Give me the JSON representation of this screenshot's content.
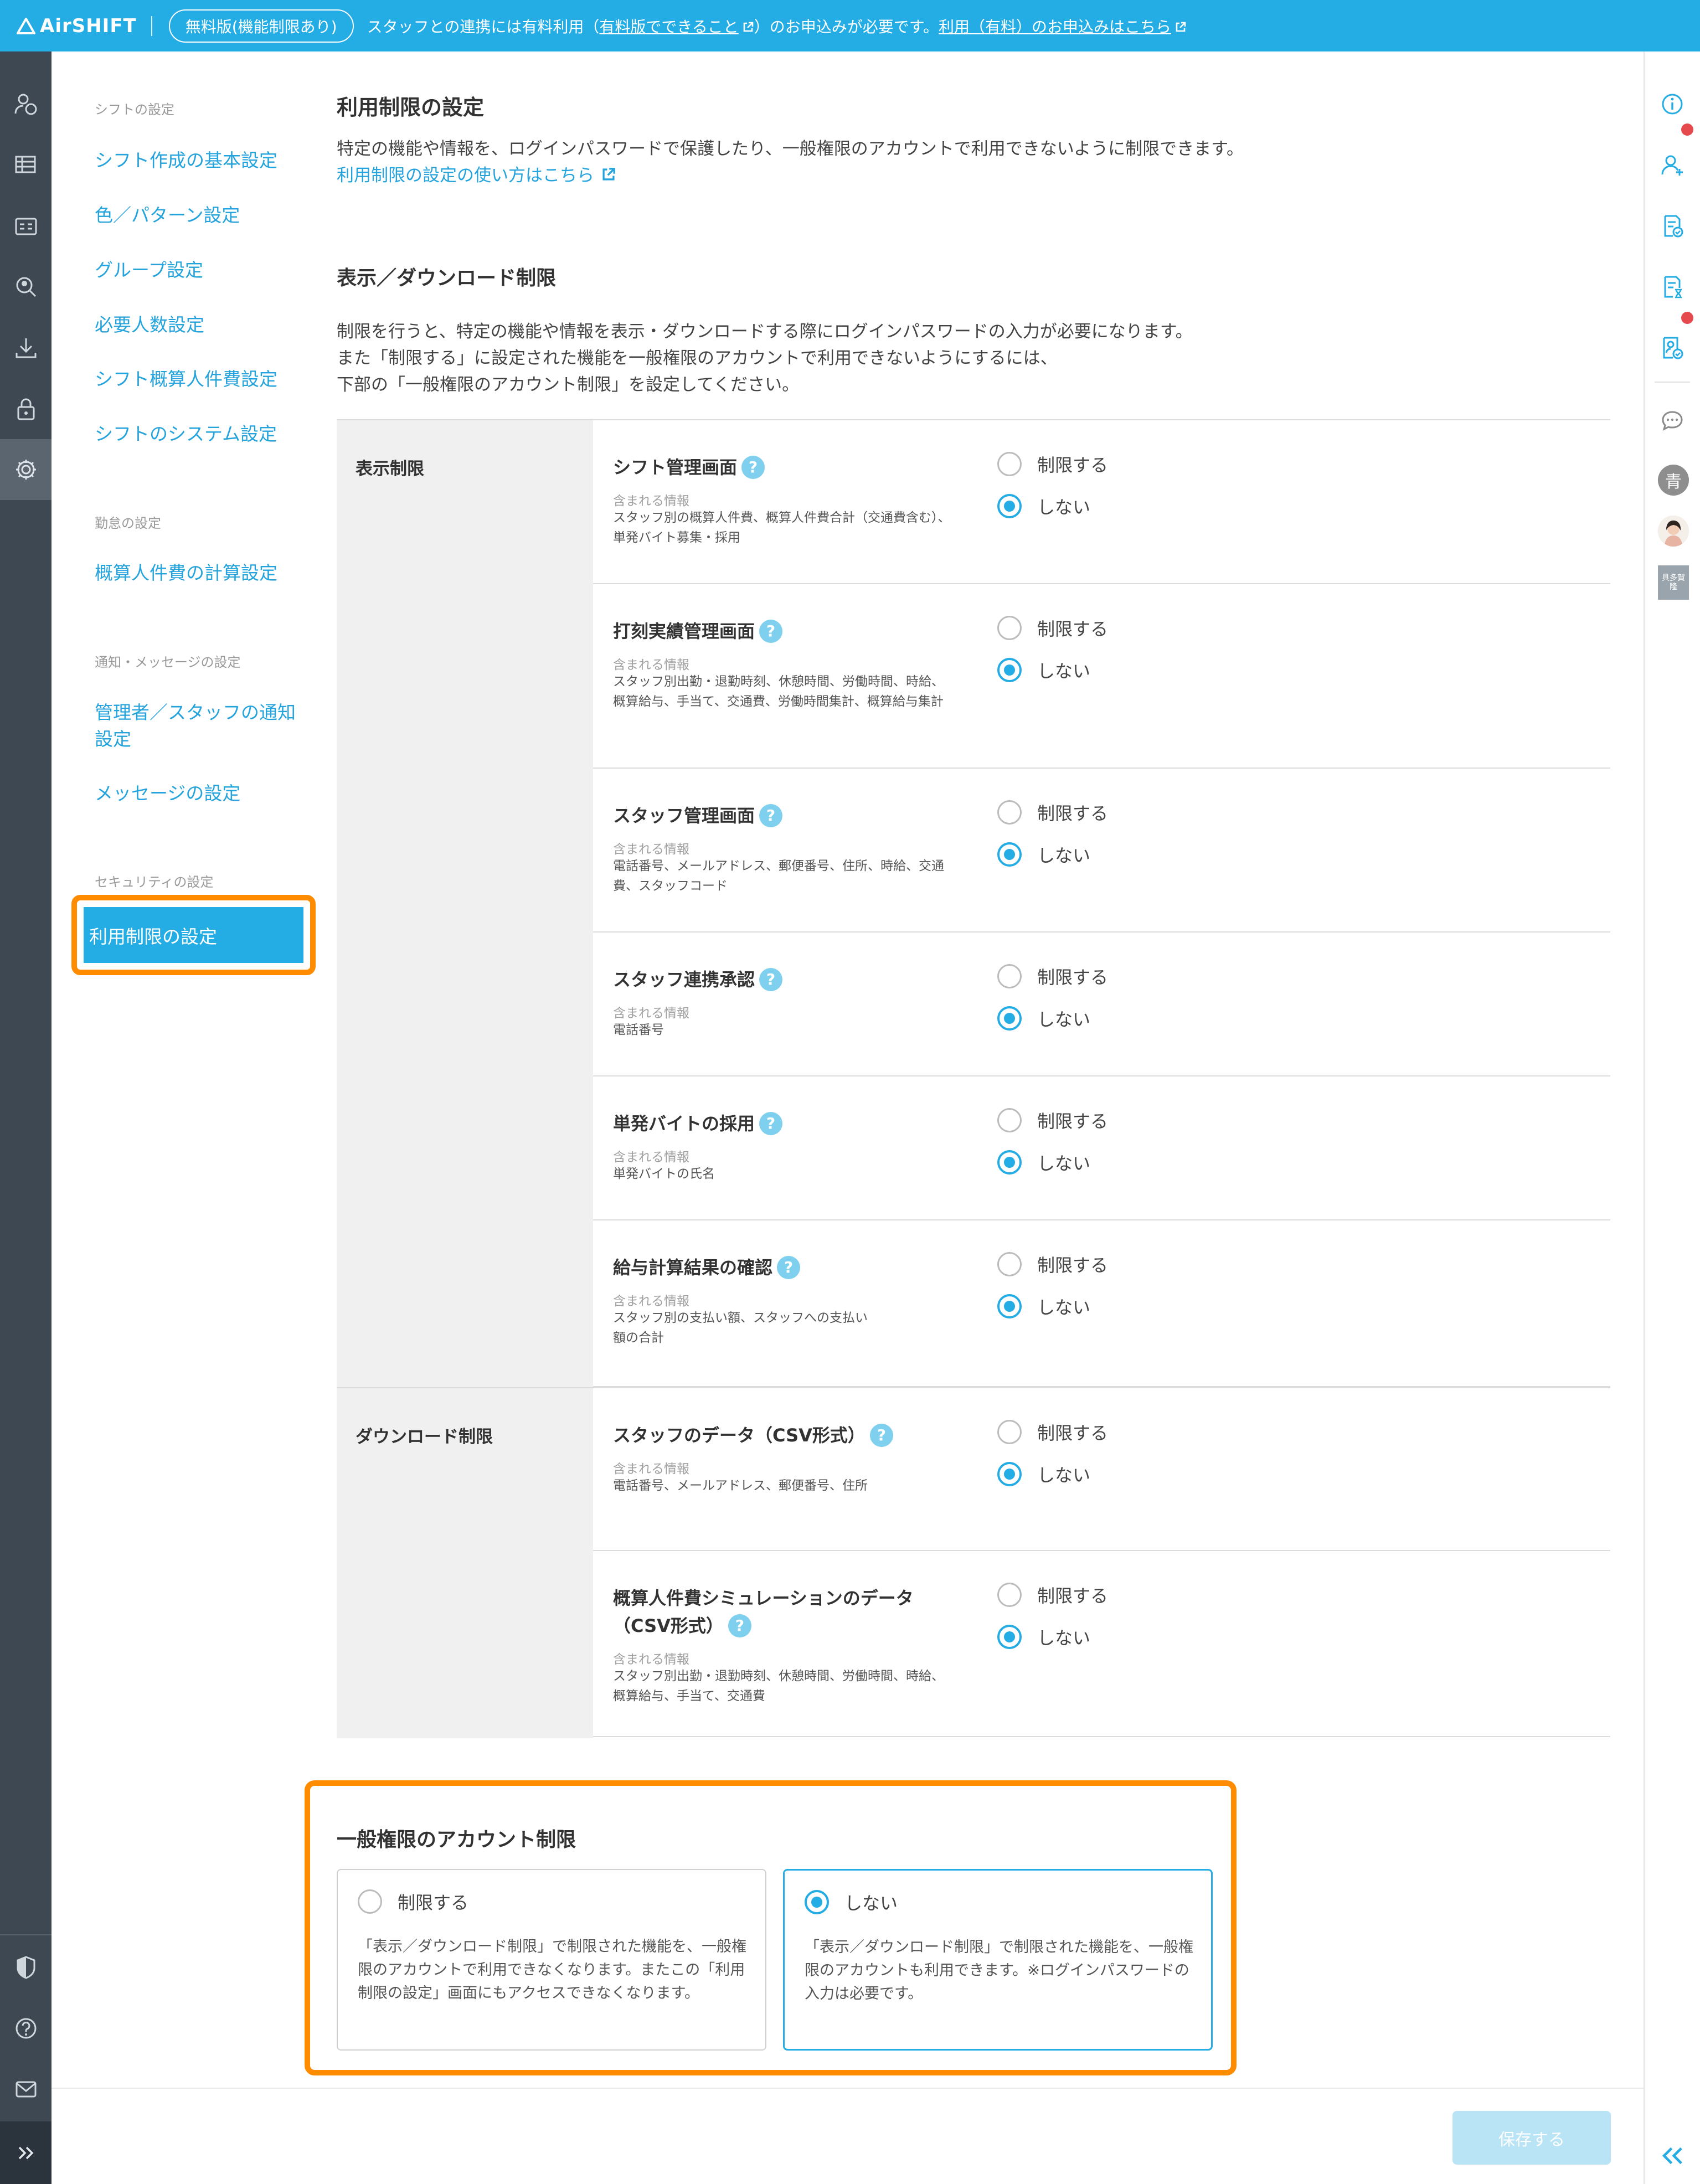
{
  "topbar": {
    "brand": "AirSHIFT",
    "plan_badge": "無料版(機能制限あり)",
    "msg_prefix": "スタッフとの連携には有料利用（",
    "msg_link1": "有料版でできること",
    "msg_middle": "）のお申込みが必要です。",
    "msg_link2": "利用（有料）のお申込みはこちら"
  },
  "nav": {
    "groups": [
      {
        "heading": "シフトの設定",
        "items": [
          "シフト作成の基本設定",
          "色／パターン設定",
          "グループ設定",
          "必要人数設定",
          "シフト概算人件費設定",
          "シフトのシステム設定"
        ]
      },
      {
        "heading": "勤怠の設定",
        "items": [
          "概算人件費の計算設定"
        ]
      },
      {
        "heading": "通知・メッセージの設定",
        "items": [
          "管理者／スタッフの通知設定",
          "メッセージの設定"
        ]
      },
      {
        "heading": "セキュリティの設定",
        "items": [
          "利用制限の設定"
        ]
      }
    ]
  },
  "page": {
    "title": "利用制限の設定",
    "description": "特定の機能や情報を、ログインパスワードで保護したり、一般権限のアカウントで利用できないように制限できます。",
    "help_link": "利用制限の設定の使い方はこちら"
  },
  "display_section": {
    "title": "表示／ダウンロード制限",
    "desc_line1": "制限を行うと、特定の機能や情報を表示・ダウンロードする際にログインパスワードの入力が必要になります。",
    "desc_line2": "また「制限する」に設定された機能を一般権限のアカウントで利用できないようにするには、",
    "desc_line3": "下部の「一般権限のアカウント制限」を設定してください。",
    "info_heading": "含まれる情報",
    "option_restrict": "制限する",
    "option_none": "しない",
    "help_mark": "?",
    "categories": [
      {
        "name": "表示制限",
        "rows": [
          {
            "name": "シフト管理画面",
            "info": "スタッフ別の概算人件費、概算人件費合計（交通費含む）、単発バイト募集・採用",
            "selected": "none"
          },
          {
            "name": "打刻実績管理画面",
            "info": "スタッフ別出勤・退勤時刻、休憩時間、労働時間、時給、概算給与、手当て、交通費、労働時間集計、概算給与集計",
            "selected": "none"
          },
          {
            "name": "スタッフ管理画面",
            "info": "電話番号、メールアドレス、郵便番号、住所、時給、交通費、スタッフコード",
            "selected": "none"
          },
          {
            "name": "スタッフ連携承認",
            "info": "電話番号",
            "selected": "none"
          },
          {
            "name": "単発バイトの採用",
            "info": "単発バイトの氏名",
            "selected": "none"
          },
          {
            "name": "給与計算結果の確認",
            "info": "スタッフ別の支払い額、スタッフへの支払い額の合計",
            "selected": "none"
          }
        ]
      },
      {
        "name": "ダウンロード制限",
        "rows": [
          {
            "name": "スタッフのデータ（CSV形式）",
            "info": "電話番号、メールアドレス、郵便番号、住所",
            "selected": "none"
          },
          {
            "name": "概算人件費シミュレーションのデータ（CSV形式）",
            "info": "スタッフ別出勤・退勤時刻、休憩時間、労働時間、時給、概算給与、手当て、交通費",
            "selected": "none"
          }
        ]
      }
    ]
  },
  "account_section": {
    "title": "一般権限のアカウント制限",
    "cards": [
      {
        "label": "制限する",
        "description": "「表示／ダウンロード制限」で制限された機能を、一般権限のアカウントで利用できなくなります。またこの「利用制限の設定」画面にもアクセスできなくなります。",
        "selected": false
      },
      {
        "label": "しない",
        "description": "「表示／ダウンロード制限」で制限された機能を、一般権限のアカウントも利用できます。※ログインパスワードの入力は必要です。",
        "selected": true
      }
    ]
  },
  "footer": {
    "save_label": "保存する"
  },
  "rightrail": {
    "avatar1_text": "青",
    "badge_text": "具多賀隆"
  },
  "colors": {
    "brand": "#24ace4",
    "highlight": "#ff8c00",
    "rail": "#3d4852",
    "badge": "#e5484d"
  }
}
